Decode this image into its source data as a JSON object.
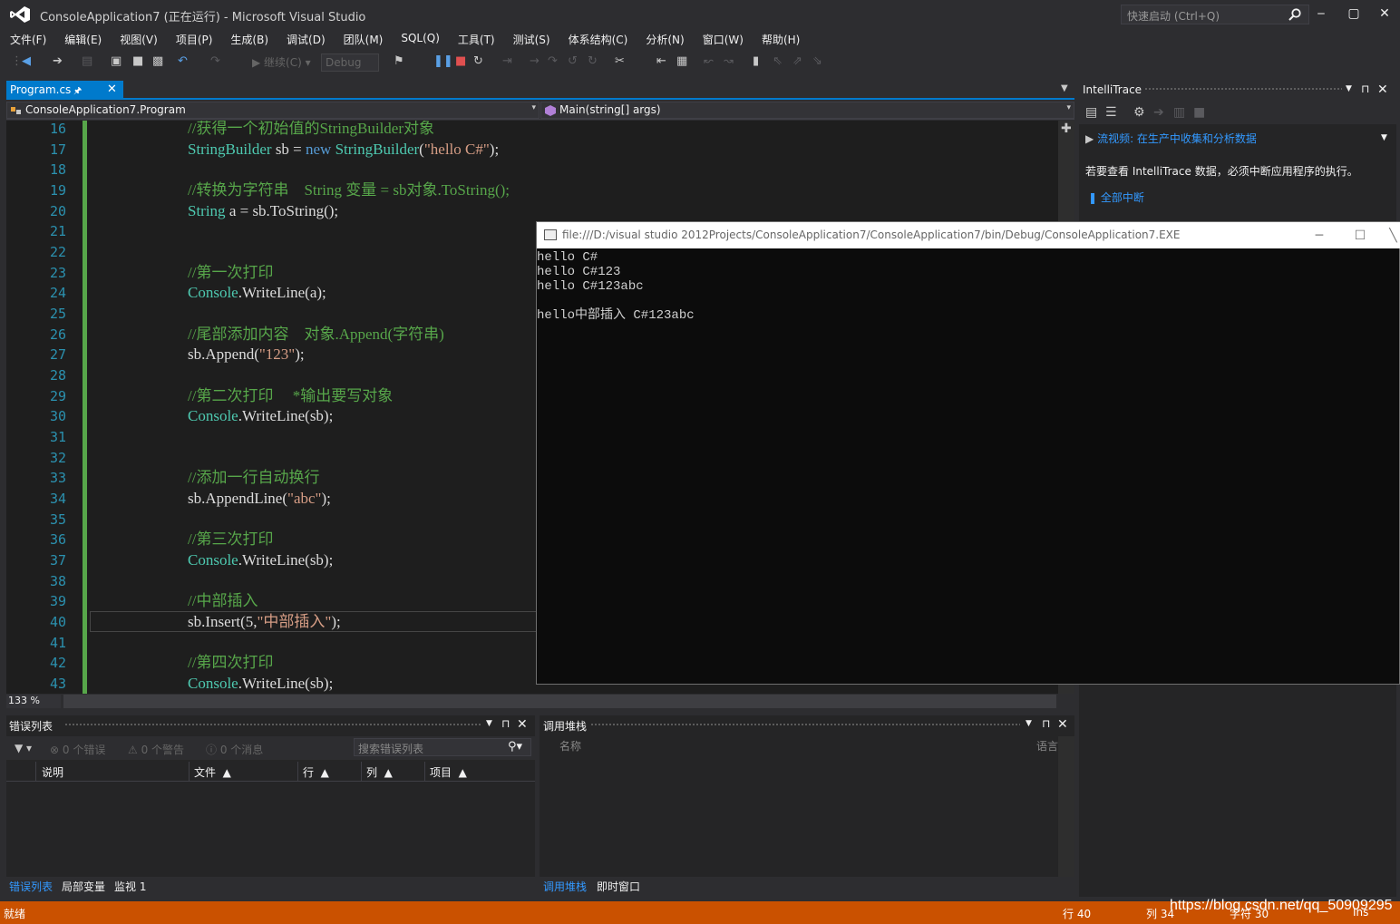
{
  "window": {
    "title": "ConsoleApplication7 (正在运行) - Microsoft Visual Studio",
    "quick_launch_placeholder": "快速启动 (Ctrl+Q)",
    "controls": [
      "‒",
      "▢",
      "✕"
    ]
  },
  "menu": [
    "文件(F)",
    "编辑(E)",
    "视图(V)",
    "项目(P)",
    "生成(B)",
    "调试(D)",
    "团队(M)",
    "SQL(Q)",
    "工具(T)",
    "测试(S)",
    "体系结构(C)",
    "分析(N)",
    "窗口(W)",
    "帮助(H)"
  ],
  "toolbar": {
    "continue_label": "▶ 继续(C) ▾",
    "config_value": "Debug",
    "icons": [
      "back-icon",
      "forward-icon",
      "new-project-icon",
      "open-icon",
      "save-icon",
      "save-all-icon",
      "undo-icon",
      "redo-icon",
      "continue-icon",
      "attach-icon",
      "pause-icon",
      "stop-icon",
      "restart-icon",
      "show-next-statement-icon",
      "step-into-icon",
      "step-over-icon",
      "step-out-icon",
      "hex-icon",
      "breakpoint-icon",
      "comment-icon",
      "uncomment-icon",
      "bookmark-icon",
      "prev-bookmark-icon",
      "next-bookmark-icon",
      "clear-bookmark-icon"
    ]
  },
  "editor": {
    "tab_label": "Program.cs",
    "nav_class": "ConsoleApplication7.Program",
    "nav_member": "Main(string[] args)",
    "zoom": "133 %",
    "lines": [
      {
        "n": "16",
        "parts": [
          {
            "t": "//获得一个初始值的StringBuilder对象",
            "c": "comment"
          }
        ]
      },
      {
        "n": "17",
        "parts": [
          {
            "t": "StringBuilder",
            "c": "type"
          },
          {
            "t": " sb = ",
            "c": "plain"
          },
          {
            "t": "new",
            "c": "kw"
          },
          {
            "t": " ",
            "c": "plain"
          },
          {
            "t": "StringBuilder",
            "c": "type"
          },
          {
            "t": "(",
            "c": "plain"
          },
          {
            "t": "\"hello C#\"",
            "c": "str"
          },
          {
            "t": ");",
            "c": "plain"
          }
        ]
      },
      {
        "n": "18",
        "parts": []
      },
      {
        "n": "19",
        "parts": [
          {
            "t": "//转换为字符串    String 变量 = sb对象.ToString();",
            "c": "comment"
          }
        ]
      },
      {
        "n": "20",
        "parts": [
          {
            "t": "String",
            "c": "type"
          },
          {
            "t": " a = sb.ToString();",
            "c": "plain"
          }
        ]
      },
      {
        "n": "21",
        "parts": []
      },
      {
        "n": "22",
        "parts": []
      },
      {
        "n": "23",
        "parts": [
          {
            "t": "//第一次打印",
            "c": "comment"
          }
        ]
      },
      {
        "n": "24",
        "parts": [
          {
            "t": "Console",
            "c": "type"
          },
          {
            "t": ".WriteLine(a);",
            "c": "plain"
          }
        ]
      },
      {
        "n": "25",
        "parts": []
      },
      {
        "n": "26",
        "parts": [
          {
            "t": "//尾部添加内容    对象.Append(字符串)",
            "c": "comment"
          }
        ]
      },
      {
        "n": "27",
        "parts": [
          {
            "t": "sb.Append(",
            "c": "plain"
          },
          {
            "t": "\"123\"",
            "c": "str"
          },
          {
            "t": ");",
            "c": "plain"
          }
        ]
      },
      {
        "n": "28",
        "parts": []
      },
      {
        "n": "29",
        "parts": [
          {
            "t": "//第二次打印     *输出要写对象",
            "c": "comment"
          }
        ]
      },
      {
        "n": "30",
        "parts": [
          {
            "t": "Console",
            "c": "type"
          },
          {
            "t": ".WriteLine(sb);",
            "c": "plain"
          }
        ]
      },
      {
        "n": "31",
        "parts": []
      },
      {
        "n": "32",
        "parts": []
      },
      {
        "n": "33",
        "parts": [
          {
            "t": "//添加一行自动换行",
            "c": "comment"
          }
        ]
      },
      {
        "n": "34",
        "parts": [
          {
            "t": "sb.AppendLine(",
            "c": "plain"
          },
          {
            "t": "\"abc\"",
            "c": "str"
          },
          {
            "t": ");",
            "c": "plain"
          }
        ]
      },
      {
        "n": "35",
        "parts": []
      },
      {
        "n": "36",
        "parts": [
          {
            "t": "//第三次打印",
            "c": "comment"
          }
        ]
      },
      {
        "n": "37",
        "parts": [
          {
            "t": "Console",
            "c": "type"
          },
          {
            "t": ".WriteLine(sb);",
            "c": "plain"
          }
        ]
      },
      {
        "n": "38",
        "parts": []
      },
      {
        "n": "39",
        "parts": [
          {
            "t": "//中部插入",
            "c": "comment"
          }
        ]
      },
      {
        "n": "40",
        "parts": [
          {
            "t": "sb.Insert(5,",
            "c": "plain"
          },
          {
            "t": "\"中部插入\"",
            "c": "str"
          },
          {
            "t": ");",
            "c": "plain"
          }
        ]
      },
      {
        "n": "41",
        "parts": []
      },
      {
        "n": "42",
        "parts": [
          {
            "t": "//第四次打印",
            "c": "comment"
          }
        ]
      },
      {
        "n": "43",
        "parts": [
          {
            "t": "Console",
            "c": "type"
          },
          {
            "t": ".WriteLine(sb);",
            "c": "plain"
          }
        ]
      }
    ]
  },
  "intellitrace": {
    "title": "IntelliTrace",
    "video_link": "流视频: 在生产中收集和分析数据",
    "note": "若要查看 IntelliTrace 数据，必须中断应用程序的执行。",
    "break_all": "全部中断"
  },
  "console": {
    "title": "file:///D:/visual studio 2012Projects/ConsoleApplication7/ConsoleApplication7/bin/Debug/ConsoleApplication7.EXE",
    "output": [
      "hello C#",
      "hello C#123",
      "hello C#123abc",
      "",
      "hello中部插入 C#123abc"
    ]
  },
  "error_list": {
    "title": "错误列表",
    "errors": "0 个错误",
    "warnings": "0 个警告",
    "messages": "0 个消息",
    "search_placeholder": "搜索错误列表",
    "columns": [
      "说明",
      "文件",
      "行",
      "列",
      "项目"
    ]
  },
  "call_stack": {
    "title": "调用堆栈",
    "columns": [
      "名称",
      "语言"
    ]
  },
  "bottom_tabs_left": [
    "错误列表",
    "局部变量",
    "监视 1"
  ],
  "bottom_tabs_right": [
    "调用堆栈",
    "即时窗口"
  ],
  "status": {
    "ready": "就绪",
    "line": "行 40",
    "col": "列 34",
    "char": "字符 30",
    "mode": "Ins"
  },
  "watermark": "https://blog.csdn.net/qq_50909295",
  "colors": {
    "accent": "#007acc",
    "statusbar": "#ca5100",
    "comment": "#57a64a",
    "type": "#4ec9b0",
    "keyword": "#569cd6",
    "string": "#d69d85"
  }
}
